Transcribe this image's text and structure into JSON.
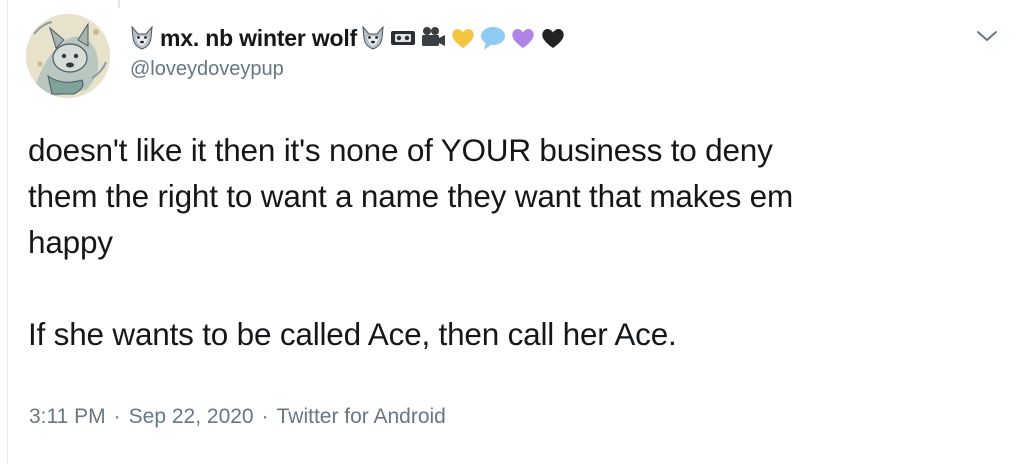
{
  "user": {
    "display_name": "mx. nb winter wolf",
    "handle": "@loveydoveypup",
    "name_emoji_icons": [
      "wolf-face-icon",
      "videocassette-icon",
      "movie-camera-icon",
      "yellow-heart-icon",
      "speech-balloon-icon",
      "purple-heart-icon",
      "black-heart-icon"
    ]
  },
  "tweet": {
    "lines": [
      "doesn't like it then it's none of YOUR business to deny",
      "them the right to want a name they want that makes em",
      "happy",
      "",
      "If she wants to be called Ace, then call her Ace."
    ]
  },
  "meta": {
    "time": "3:11 PM",
    "separator": "·",
    "date": "Sep 22, 2020",
    "source": "Twitter for Android"
  },
  "colors": {
    "text": "#14171a",
    "secondary": "#657786",
    "yellow_heart": "#f5c542",
    "purple_heart": "#b084e6",
    "black_heart": "#232323",
    "speech_balloon": "#8ecbf2"
  }
}
